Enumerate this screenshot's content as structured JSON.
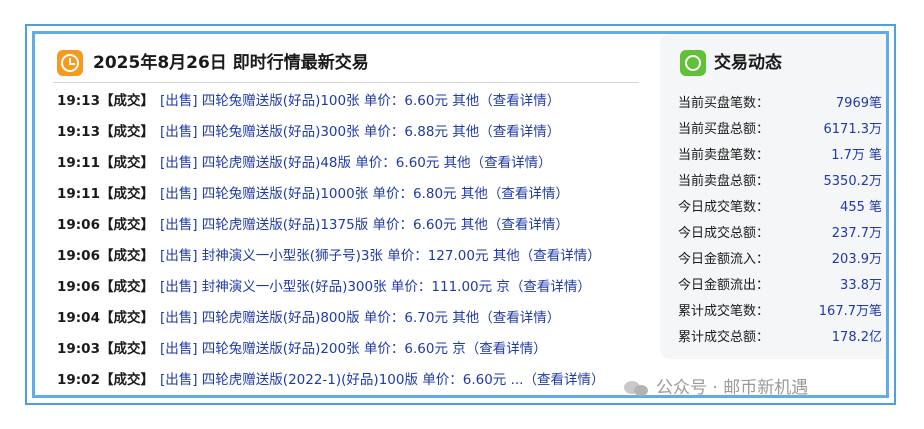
{
  "left_panel": {
    "title": "2025年8月26日 即时行情最新交易",
    "icon": "clock-icon",
    "trades": [
      {
        "time": "19:13",
        "tag": "【成交】",
        "desc": "[出售] 四轮兔赠送版(好品)100张 单价：6.60元 其他",
        "detail": "（查看详情）"
      },
      {
        "time": "19:13",
        "tag": "【成交】",
        "desc": "[出售] 四轮兔赠送版(好品)300张 单价：6.88元 其他",
        "detail": "（查看详情）"
      },
      {
        "time": "19:11",
        "tag": "【成交】",
        "desc": "[出售] 四轮虎赠送版(好品)48版 单价：6.60元 其他",
        "detail": "（查看详情）"
      },
      {
        "time": "19:11",
        "tag": "【成交】",
        "desc": "[出售] 四轮兔赠送版(好品)1000张 单价：6.80元 其他",
        "detail": "（查看详情）"
      },
      {
        "time": "19:06",
        "tag": "【成交】",
        "desc": "[出售] 四轮虎赠送版(好品)1375版 单价：6.60元 其他",
        "detail": "（查看详情）"
      },
      {
        "time": "19:06",
        "tag": "【成交】",
        "desc": "[出售] 封神演义一小型张(狮子号)3张 单价：127.00元 其他",
        "detail": "（查看详情）"
      },
      {
        "time": "19:06",
        "tag": "【成交】",
        "desc": "[出售] 封神演义一小型张(好品)300张 单价：111.00元 京",
        "detail": "（查看详情）"
      },
      {
        "time": "19:04",
        "tag": "【成交】",
        "desc": "[出售] 四轮虎赠送版(好品)800版 单价：6.70元 其他",
        "detail": "（查看详情）"
      },
      {
        "time": "19:03",
        "tag": "【成交】",
        "desc": "[出售] 四轮兔赠送版(好品)200张 单价：6.60元 京",
        "detail": "（查看详情）"
      },
      {
        "time": "19:02",
        "tag": "【成交】",
        "desc": "[出售] 四轮虎赠送版(2022-1)(好品)100版 单价：6.60元 ...",
        "detail": "（查看详情）"
      }
    ]
  },
  "right_panel": {
    "title": "交易动态",
    "icon": "swap-arrows-icon",
    "stats": [
      {
        "label": "当前买盘笔数：",
        "value": "7969笔"
      },
      {
        "label": "当前买盘总额：",
        "value": "6171.3万"
      },
      {
        "label": "当前卖盘笔数：",
        "value": "1.7万 笔"
      },
      {
        "label": "当前卖盘总额：",
        "value": "5350.2万"
      },
      {
        "label": "今日成交笔数：",
        "value": "455 笔"
      },
      {
        "label": "今日成交总额：",
        "value": "237.7万"
      },
      {
        "label": "今日金额流入：",
        "value": "203.9万"
      },
      {
        "label": "今日金额流出：",
        "value": "33.8万"
      },
      {
        "label": "累计成交笔数：",
        "value": "167.7万笔"
      },
      {
        "label": "累计成交总额：",
        "value": "178.2亿"
      }
    ]
  },
  "watermark": {
    "text": "公众号 · 邮币新机遇"
  },
  "colors": {
    "frame": "#4d9fe0",
    "link": "#1f3aa8",
    "clock": "#f39a1f",
    "swap": "#5fc236"
  }
}
